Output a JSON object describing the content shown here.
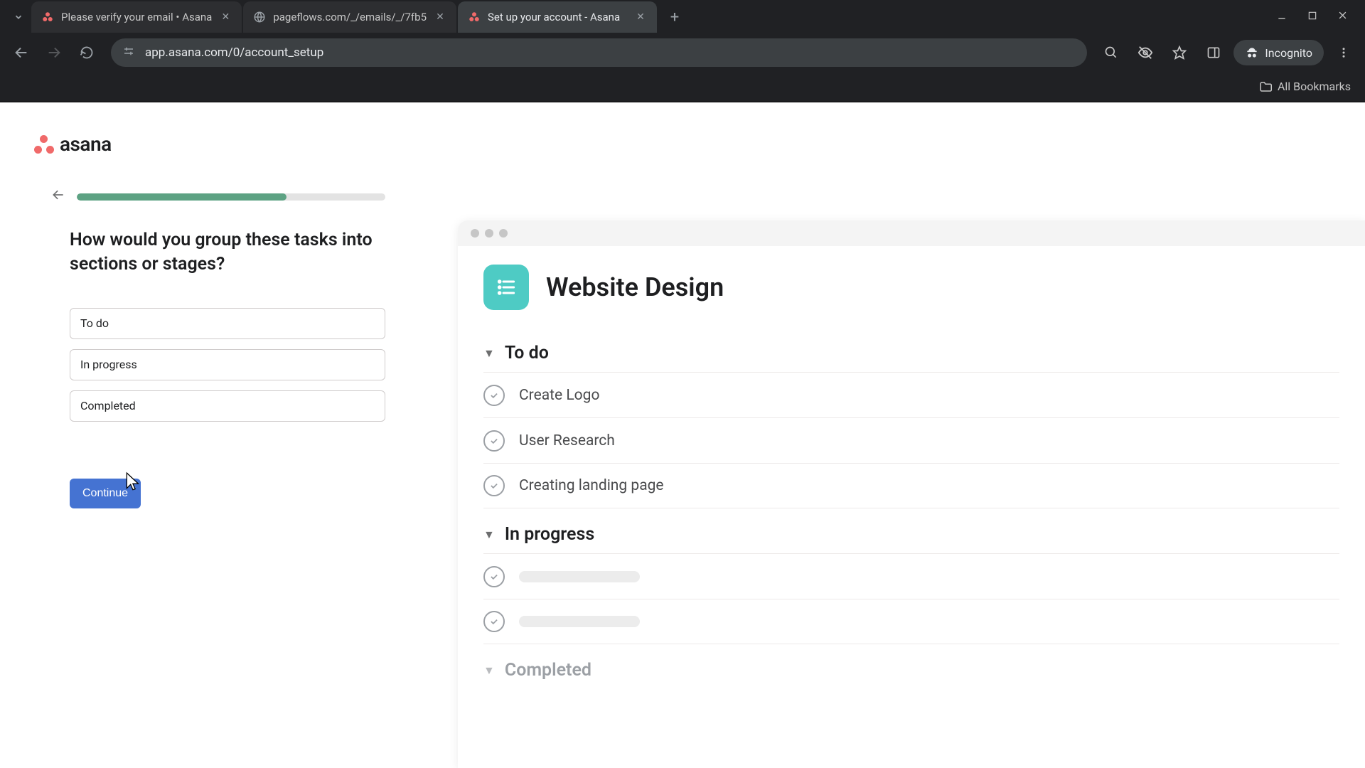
{
  "browser": {
    "tabs": [
      {
        "title": "Please verify your email • Asana",
        "favicon": "asana"
      },
      {
        "title": "pageflows.com/_/emails/_/7fb5",
        "favicon": "globe"
      },
      {
        "title": "Set up your account - Asana",
        "favicon": "asana"
      }
    ],
    "active_tab_index": 2,
    "url": "app.asana.com/0/account_setup",
    "incognito_label": "Incognito",
    "bookmarks_label": "All Bookmarks"
  },
  "brand": {
    "name": "asana"
  },
  "setup": {
    "progress_percent": 68,
    "question": "How would you group these tasks into sections or stages?",
    "inputs": [
      "To do",
      "In progress",
      "Completed"
    ],
    "continue_label": "Continue"
  },
  "preview": {
    "project_title": "Website Design",
    "sections": [
      {
        "name": "To do",
        "muted": false,
        "tasks": [
          "Create Logo",
          "User Research",
          "Creating landing page"
        ]
      },
      {
        "name": "In progress",
        "muted": false,
        "tasks": [
          "",
          ""
        ]
      },
      {
        "name": "Completed",
        "muted": true,
        "tasks": []
      }
    ]
  }
}
